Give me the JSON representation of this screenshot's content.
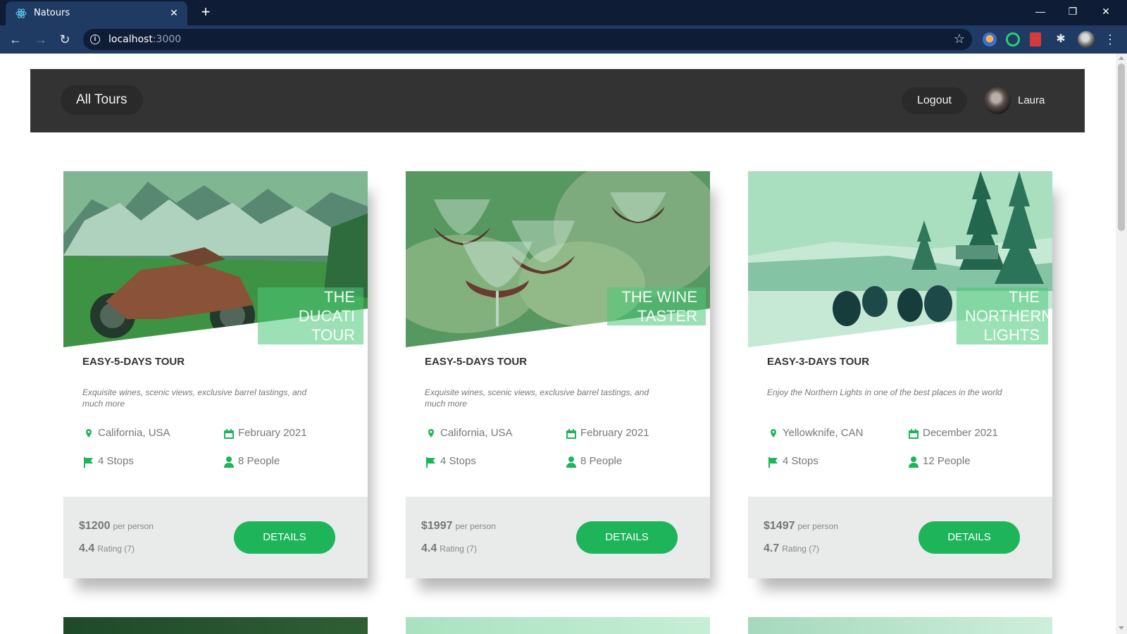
{
  "browser": {
    "tab_title": "Natours",
    "url_host": "localhost",
    "url_port": ":3000"
  },
  "header": {
    "all_tours": "All Tours",
    "logout": "Logout",
    "user": "Laura"
  },
  "tours": [
    {
      "title": "The Ducati Tour",
      "subhead": "Easy-5-Days Tour",
      "summary": "Exquisite wines, scenic views, exclusive barrel tastings, and much more",
      "location": "California, USA",
      "date": "February 2021",
      "stops": "4 Stops",
      "people": "8 People",
      "price": "$1200",
      "price_unit": "per person",
      "rating": "4.4",
      "rating_label": "Rating (7)",
      "button": "Details"
    },
    {
      "title": "The Wine Taster",
      "subhead": "Easy-5-Days Tour",
      "summary": "Exquisite wines, scenic views, exclusive barrel tastings, and much more",
      "location": "California, USA",
      "date": "February 2021",
      "stops": "4 Stops",
      "people": "8 People",
      "price": "$1997",
      "price_unit": "per person",
      "rating": "4.4",
      "rating_label": "Rating (7)",
      "button": "Details"
    },
    {
      "title": "The Northern Lights",
      "subhead": "Easy-3-Days Tour",
      "summary": "Enjoy the Northern Lights in one of the best places in the world",
      "location": "Yellowknife, CAN",
      "date": "December 2021",
      "stops": "4 Stops",
      "people": "12 People",
      "price": "$1497",
      "price_unit": "per person",
      "rating": "4.7",
      "rating_label": "Rating (7)",
      "button": "Details"
    }
  ],
  "colors": {
    "accent": "#1db45a",
    "header_bg": "#333333",
    "browser_frame": "#0e1c36",
    "browser_toolbar": "#1f3a63",
    "card_footer": "#e8ebe9"
  }
}
